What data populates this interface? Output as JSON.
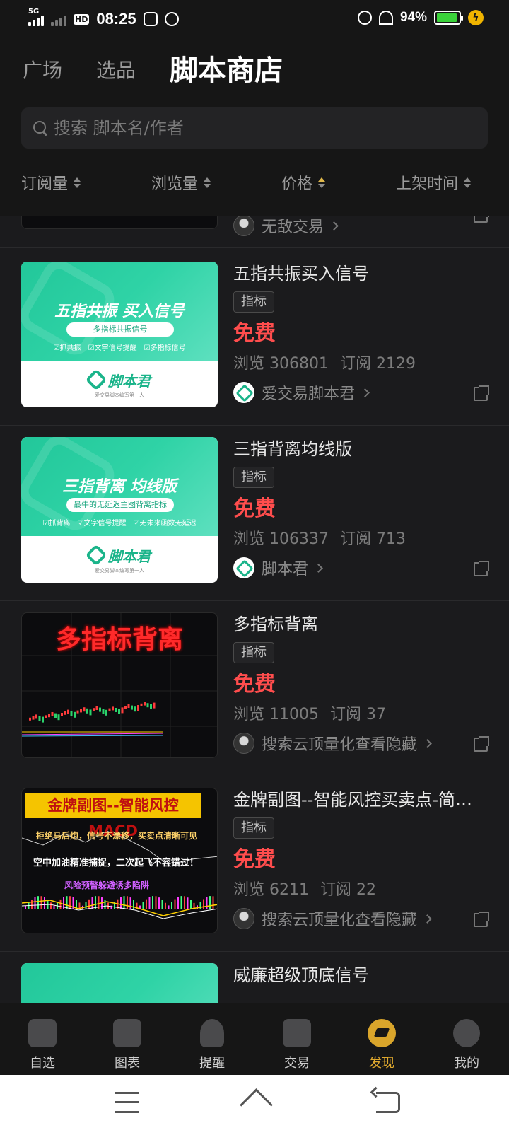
{
  "status_bar": {
    "network": "5G",
    "hd": "HD",
    "time": "08:25",
    "battery": "94%"
  },
  "header": {
    "tabs": [
      {
        "label": "广场"
      },
      {
        "label": "选品"
      },
      {
        "label": "脚本商店"
      }
    ],
    "search_placeholder": "搜索 脚本名/作者",
    "sorts": [
      {
        "label": "订阅量"
      },
      {
        "label": "浏览量"
      },
      {
        "label": "价格"
      },
      {
        "label": "上架时间"
      }
    ]
  },
  "items": [
    {
      "title": "",
      "author": "无敌交易"
    },
    {
      "title": "五指共振买入信号",
      "tag": "指标",
      "price": "免费",
      "views": "浏览 306801",
      "subs": "订阅 2129",
      "author": "爱交易脚本君",
      "thumb_title": "五指共振 买入信号",
      "thumb_pill": "多指标共振信号",
      "thumb_ticks": "☑抓共振　☑文字信号提醒　☑多指标信号",
      "thumb_brand": "脚本君",
      "thumb_brand_sub": "爱交易脚本编写第一人"
    },
    {
      "title": "三指背离均线版",
      "tag": "指标",
      "price": "免费",
      "views": "浏览 106337",
      "subs": "订阅 713",
      "author": "脚本君",
      "thumb_title": "三指背离 均线版",
      "thumb_pill": "最牛的无延迟主图背离指标",
      "thumb_ticks": "☑抓背离　☑文字信号提醒　☑无未来函数无延迟",
      "thumb_brand": "脚本君",
      "thumb_brand_sub": "爱交易脚本编写第一人"
    },
    {
      "title": "多指标背离",
      "tag": "指标",
      "price": "免费",
      "views": "浏览 11005",
      "subs": "订阅 37",
      "author": "搜索云顶量化查看隐藏",
      "thumb_title": "多指标背离"
    },
    {
      "title": "金牌副图--智能风控买卖点-简…",
      "tag": "指标",
      "price": "免费",
      "views": "浏览 6211",
      "subs": "订阅 22",
      "author": "搜索云顶量化查看隐藏",
      "thumb_banner": "金牌副图--智能风控MACD",
      "thumb_line1": "拒绝马后炮，信号不漂移，买卖点清晰可见",
      "thumb_line2": "空中加油精准捕捉，二次起飞不容错过！",
      "thumb_line3": "风险预警躲避诱多陷阱"
    },
    {
      "title": "威廉超级顶底信号"
    }
  ],
  "bottom_nav": [
    {
      "label": "自选",
      "icon": "home-icon"
    },
    {
      "label": "图表",
      "icon": "chart-icon"
    },
    {
      "label": "提醒",
      "icon": "bell-icon"
    },
    {
      "label": "交易",
      "icon": "trade-icon"
    },
    {
      "label": "发现",
      "icon": "discover-icon"
    },
    {
      "label": "我的",
      "icon": "user-icon"
    }
  ],
  "colors": {
    "background": "#1b1b1d",
    "price": "#ff4d4d",
    "accent": "#e0a92e",
    "brand_green": "#1bb48a"
  }
}
